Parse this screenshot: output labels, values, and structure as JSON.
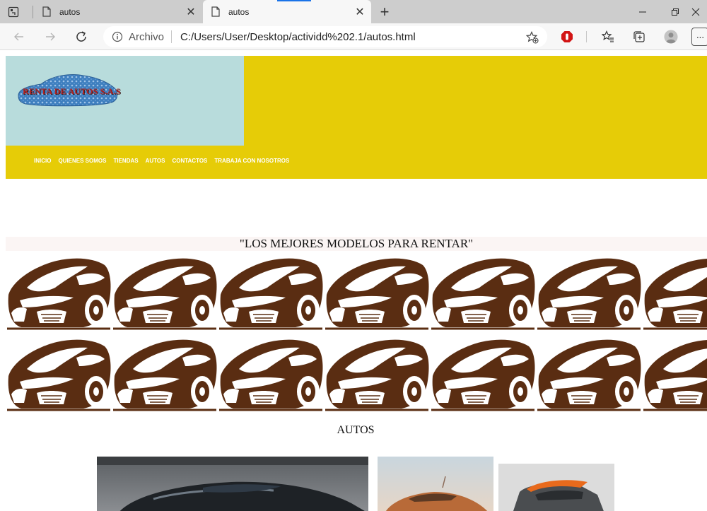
{
  "browser": {
    "tabs": [
      {
        "title": "autos",
        "active": false
      },
      {
        "title": "autos",
        "active": true
      }
    ],
    "address": {
      "scheme_label": "Archivo",
      "url": "C:/Users/User/Desktop/actividd%202.1/autos.html"
    },
    "colors": {
      "tabbar": "#cdcdcd",
      "toolbar": "#f7f7f7",
      "accent": "#1a73e8"
    }
  },
  "site": {
    "logo_text": "RENTA DE AUTOS S.A.S",
    "menu": [
      "INICIO",
      "QUIENES SOMOS",
      "TIENDAS",
      "AUTOS",
      "CONTACTOS",
      "TRABAJA CON NOSOTROS"
    ],
    "slogan": "\"LOS MEJORES MODELOS PARA RENTAR\"",
    "section_heading": "AUTOS",
    "colors": {
      "header": "#e6cc07",
      "logo_bg": "#b8dcdc",
      "pattern_car": "#5a2d12",
      "slogan_bg": "#fbf5f4"
    }
  }
}
